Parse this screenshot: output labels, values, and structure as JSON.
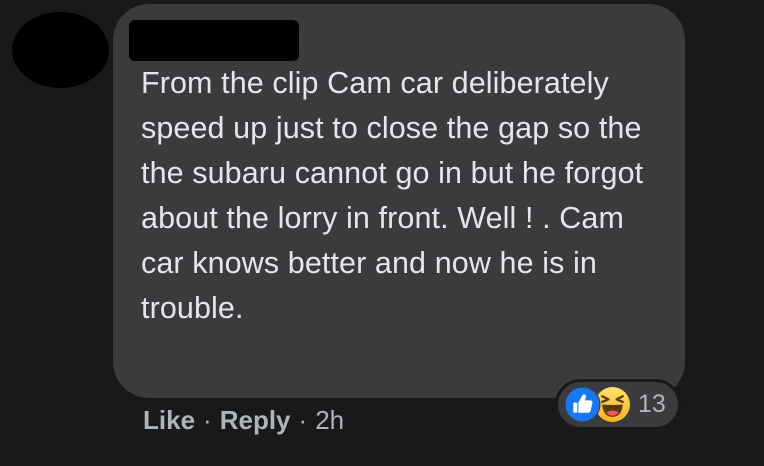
{
  "comment": {
    "text": "From the clip Cam car deliberately speed up just to close the gap so the the subaru cannot go in but he forgot about the lorry in front. Well ! . Cam car knows better and now he is in trouble."
  },
  "reactions": {
    "icons": [
      "like-icon",
      "haha-icon"
    ],
    "count": "13"
  },
  "actions": {
    "like_label": "Like",
    "reply_label": "Reply",
    "separator": "·",
    "timestamp": "2h"
  },
  "colors": {
    "page_bg": "#18191a",
    "bubble_bg": "#3a3b3c",
    "text": "#e4e6eb",
    "secondary_text": "#b0b3b8",
    "like_blue": "#1877f2",
    "haha_yellow": "#f7b125"
  }
}
